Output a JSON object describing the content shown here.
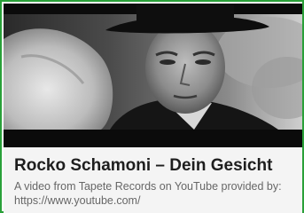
{
  "card": {
    "title": "Rocko Schamoni – Dein Gesicht",
    "description": "A video from Tapete Records on YouTube provided by: https://www.youtube.com/"
  },
  "thumbnail": {
    "icon": "video-thumbnail-image",
    "style": "black-and-white still"
  },
  "colors": {
    "border": "#2aa039",
    "caption_background": "#f4f4f4",
    "title_text": "#1e1e1e",
    "description_text": "#676767"
  }
}
